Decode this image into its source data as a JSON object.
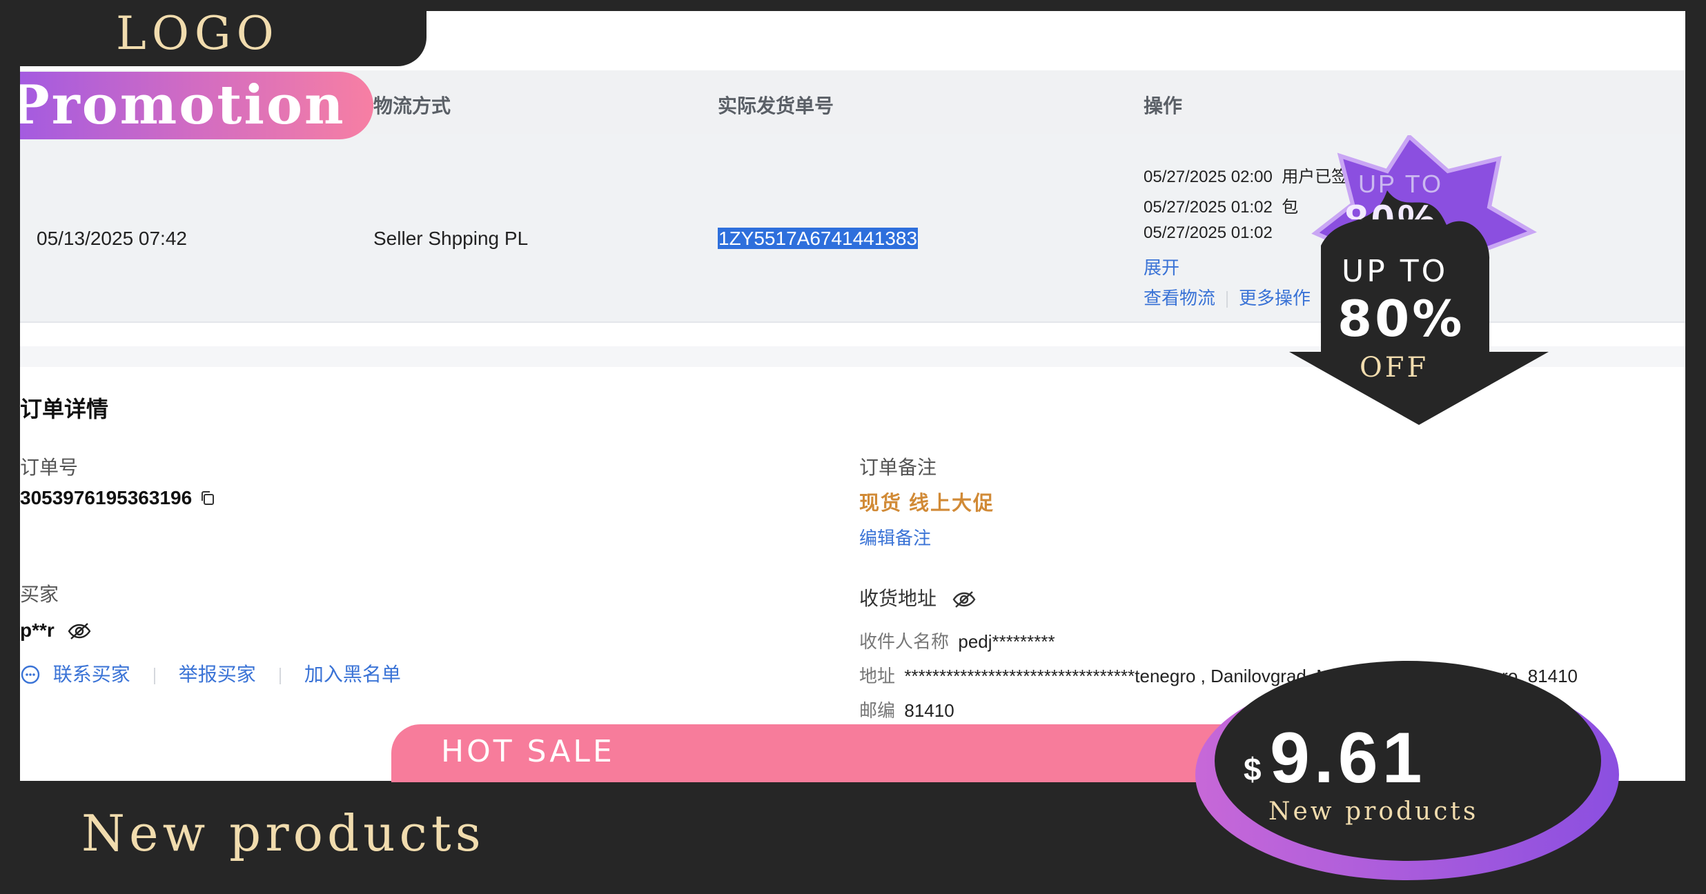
{
  "table": {
    "headers": {
      "shipping_method": "物流方式",
      "tracking_no": "实际发货单号",
      "actions": "操作"
    },
    "row": {
      "date": "05/13/2025 07:42",
      "shipping_method": "Seller Shpping PL",
      "tracking_no": "1ZY5517A6741441383",
      "log": [
        {
          "time": "05/27/2025 02:00",
          "status": "用户已签收"
        },
        {
          "time": "05/27/2025 01:02",
          "status": "包"
        },
        {
          "time": "05/27/2025 01:02",
          "status": ""
        }
      ],
      "expand": "展开",
      "view_logistics": "查看物流",
      "more_actions": "更多操作"
    }
  },
  "order": {
    "section_title": "订单详情",
    "order_no_label": "订单号",
    "order_no": "3053976195363196",
    "remark_label": "订单备注",
    "remark": "现货 线上大促",
    "edit_remark": "编辑备注",
    "buyer_label": "买家",
    "buyer_name": "p**r",
    "contact_buyer": "联系买家",
    "report_buyer": "举报买家",
    "blacklist": "加入黑名单",
    "address_label": "收货地址",
    "recipient_label": "收件人名称",
    "recipient": "pedj*********",
    "addr_label": "地址",
    "address": "*********************************tenegro , Danilovgrad, Montenegro, Montenegro, 81410",
    "zip_label": "邮编",
    "zip": "81410"
  },
  "overlays": {
    "logo": "LOGO",
    "promotion": "Promotion",
    "hot_sale": "HOT SALE",
    "hot_sale_tail": "E",
    "new_products": "New products",
    "price_currency": "$",
    "price": "9.61",
    "price_sub": "New products",
    "sale_up_to": "UP TO",
    "sale_percent": "80%",
    "sale_off": "OFF",
    "sale_bg_up_to": "UP TO",
    "sale_bg_percent": "80%"
  },
  "colors": {
    "link": "#3a73d6",
    "remark": "#d18a36",
    "frame": "#262626",
    "gold": "#f1dcae",
    "pink": "#f77c9b",
    "purple": "#8b4fe0"
  }
}
